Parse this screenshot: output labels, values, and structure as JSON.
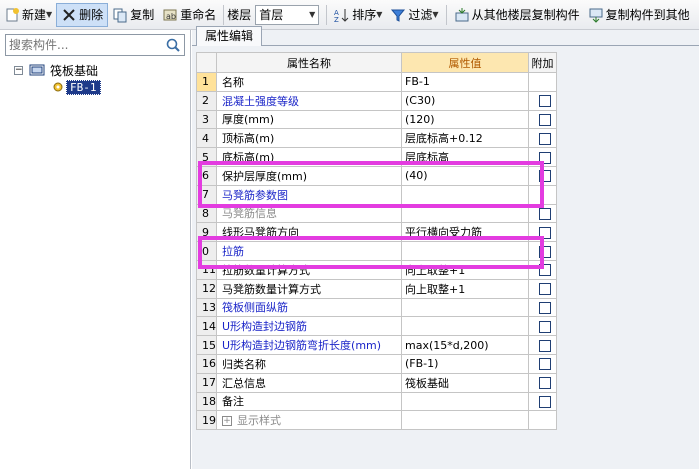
{
  "toolbar": {
    "new_label": "新建",
    "delete_label": "删除",
    "copy_label": "复制",
    "rename_label": "重命名",
    "floor_label": "楼层",
    "floor_value": "首层",
    "sort_label": "排序",
    "filter_label": "过滤",
    "copy_from_floor_label": "从其他楼层复制构件",
    "copy_to_label": "复制构件到其他"
  },
  "left_panel": {
    "search_placeholder": "搜索构件...",
    "tree": {
      "root_label": "筏板基础",
      "child_label": "FB-1"
    }
  },
  "right_panel": {
    "tab_label": "属性编辑",
    "columns": {
      "name": "属性名称",
      "value": "属性值",
      "extra": "附加"
    },
    "rows": [
      {
        "num": "1",
        "name": "名称",
        "value": "FB-1",
        "checkbox": false,
        "style": ""
      },
      {
        "num": "2",
        "name": "混凝土强度等级",
        "value": "(C30)",
        "checkbox": true,
        "style": "blue"
      },
      {
        "num": "3",
        "name": "厚度(mm)",
        "value": "(120)",
        "checkbox": true,
        "style": ""
      },
      {
        "num": "4",
        "name": "顶标高(m)",
        "value": "层底标高+0.12",
        "checkbox": true,
        "style": ""
      },
      {
        "num": "5",
        "name": "底标高(m)",
        "value": "层底标高",
        "checkbox": true,
        "style": ""
      },
      {
        "num": "6",
        "name": "保护层厚度(mm)",
        "value": "(40)",
        "checkbox": true,
        "style": ""
      },
      {
        "num": "7",
        "name": "马凳筋参数图",
        "value": "",
        "checkbox": false,
        "style": "blue"
      },
      {
        "num": "8",
        "name": "马凳筋信息",
        "value": "",
        "checkbox": true,
        "style": "gray"
      },
      {
        "num": "9",
        "name": "线形马凳筋方向",
        "value": "平行横向受力筋",
        "checkbox": true,
        "style": ""
      },
      {
        "num": "0",
        "name": "拉筋",
        "value": "",
        "checkbox": true,
        "style": "blue"
      },
      {
        "num": "11",
        "name": "拉筋数量计算方式",
        "value": "向上取整+1",
        "checkbox": true,
        "style": ""
      },
      {
        "num": "12",
        "name": "马凳筋数量计算方式",
        "value": "向上取整+1",
        "checkbox": true,
        "style": ""
      },
      {
        "num": "13",
        "name": "筏板侧面纵筋",
        "value": "",
        "checkbox": true,
        "style": "blue"
      },
      {
        "num": "14",
        "name": "U形构造封边钢筋",
        "value": "",
        "checkbox": true,
        "style": "blue"
      },
      {
        "num": "15",
        "name": "U形构造封边钢筋弯折长度(mm)",
        "value": "max(15*d,200)",
        "checkbox": true,
        "style": "blue"
      },
      {
        "num": "16",
        "name": "归类名称",
        "value": "(FB-1)",
        "checkbox": true,
        "style": ""
      },
      {
        "num": "17",
        "name": "汇总信息",
        "value": "筏板基础",
        "checkbox": true,
        "style": ""
      },
      {
        "num": "18",
        "name": "备注",
        "value": "",
        "checkbox": true,
        "style": ""
      },
      {
        "num": "19",
        "name": "显示样式",
        "value": "",
        "checkbox": false,
        "style": "gray",
        "expandable": true,
        "expander_symbol": "+"
      }
    ]
  },
  "colors": {
    "highlight": "#e33ce0",
    "selected_bg": "#1e3a8a",
    "link_blue": "#1a24c8",
    "value_header_bg": "#fde7b0"
  }
}
